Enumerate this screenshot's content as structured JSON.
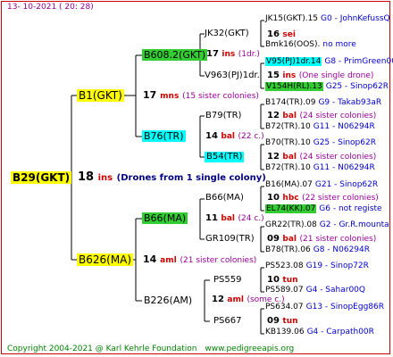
{
  "header": {
    "date": "13- 10-2021 ( 20: 28)"
  },
  "footer": {
    "copyright": "Copyright 2004-2021 @ Karl Kehrle Foundation",
    "url": "www.pedigreeapis.org"
  },
  "root": {
    "label": "B29(GKT)",
    "count": "18",
    "unit": "ins",
    "note": "(Drones from 1 single colony)"
  },
  "g1": {
    "sire": {
      "label": "B1(GKT)",
      "count": "17",
      "unit": "mns",
      "note": "(15 sister colonies)"
    },
    "dam": {
      "label": "B626(MA)",
      "count": "14",
      "unit": "aml",
      "note": "(21 sister colonies)"
    }
  },
  "g2": {
    "a": {
      "label": "B608.2(GKT)",
      "count": "17",
      "unit": "ins",
      "note": "(1dr.)"
    },
    "b": {
      "label": "B76(TR)",
      "count": "14",
      "unit": "bal",
      "note": "(22 c.)"
    },
    "c": {
      "label": "B66(MA)",
      "count": "11",
      "unit": "bal",
      "note": "(24 c.)"
    },
    "d": {
      "label": "B226(AM)",
      "count": "12",
      "unit": "aml",
      "note": "(some c.)"
    }
  },
  "g3": {
    "a1": {
      "label": "JK32(GKT)",
      "count": "16",
      "unit": "sei"
    },
    "a2": {
      "label": "V963(PJ)1dr.",
      "count": "15",
      "unit": "ins",
      "note": "(One single drone)"
    },
    "b1": {
      "label": "B79(TR)",
      "count": "12",
      "unit": "bal",
      "note": "(24 sister colonies)"
    },
    "b2": {
      "label": "B54(TR)",
      "count": "12",
      "unit": "bal",
      "note": "(24 sister colonies)"
    },
    "c1": {
      "label": "B66(MA)",
      "count": "10",
      "unit": "hbc",
      "note": "(22 sister colonies)"
    },
    "c2": {
      "label": "GR109(TR)",
      "count": "09",
      "unit": "bal",
      "note": "(21 sister colonies)"
    },
    "d1": {
      "label": "PS559",
      "count": "10",
      "unit": "tun"
    },
    "d2": {
      "label": "PS667",
      "count": "09",
      "unit": "tun"
    }
  },
  "g4": [
    {
      "label": "JK15(GKT).15",
      "extra": "G0 - JohnKefuss",
      "end": "Q",
      "hl": ""
    },
    {
      "label": "Bmk16(OOS).",
      "extra": "",
      "end": "no more",
      "hl": ""
    },
    {
      "label": "V95(PJ)1dr.14",
      "extra": "G8 - PrimGreen",
      "end": "00",
      "hl": "cyan"
    },
    {
      "label": "V154H(RL).13",
      "extra": "G25 - Sinop62",
      "end": "R",
      "hl": "green"
    },
    {
      "label": "B174(TR).09",
      "extra": "G9 - Takab93a",
      "end": "R",
      "hl": ""
    },
    {
      "label": "B72(TR).10",
      "extra": "G11 - N06294",
      "end": "R",
      "hl": ""
    },
    {
      "label": "B70(TR).10",
      "extra": "G25 - Sinop62",
      "end": "R",
      "hl": ""
    },
    {
      "label": "B72(TR).10",
      "extra": "G11 - N06294",
      "end": "R",
      "hl": ""
    },
    {
      "label": "B16(MA).07",
      "extra": "G21 - Sinop62",
      "end": "R",
      "hl": ""
    },
    {
      "label": "EL74(KK).07",
      "extra": "G6 - not registe",
      "end": "",
      "hl": "green"
    },
    {
      "label": "GR22(TR).08",
      "extra": "G2 - Gr.R.mounta",
      "end": "",
      "hl": ""
    },
    {
      "label": "B78(TR).06",
      "extra": "G8 - N06294",
      "end": "R",
      "hl": ""
    },
    {
      "label": "PS523.08",
      "extra": "G19 - Sinop72",
      "end": "R",
      "hl": ""
    },
    {
      "label": "PS589.07",
      "extra": "G4 - Sahar00",
      "end": "Q",
      "hl": ""
    },
    {
      "label": "PS634.07",
      "extra": "G13 - SinopEgg86",
      "end": "R",
      "hl": ""
    },
    {
      "label": "KB139.06",
      "extra": "G4 - Carpath00",
      "end": "R",
      "hl": ""
    }
  ]
}
